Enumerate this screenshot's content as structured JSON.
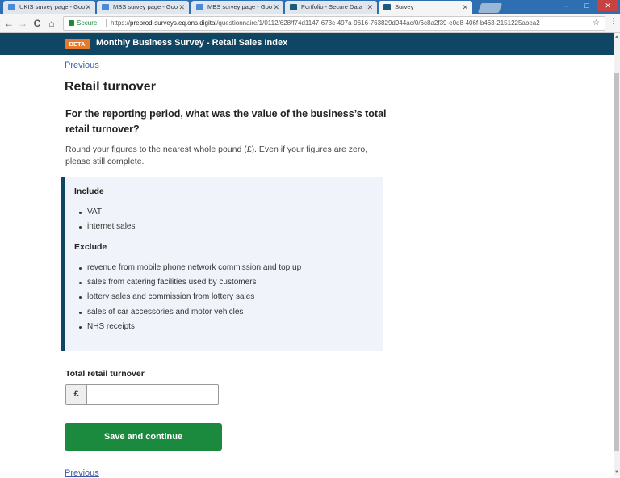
{
  "browser": {
    "tabs": [
      {
        "title": "UKIS survey page - Goo",
        "icon": "doc-icon"
      },
      {
        "title": "MBS survey page - Goo",
        "icon": "doc-icon"
      },
      {
        "title": "MBS survey page - Goo",
        "icon": "doc-icon"
      },
      {
        "title": "Portfolio - Secure Data",
        "icon": "ons-icon"
      },
      {
        "title": "Survey",
        "icon": "ons-icon"
      }
    ],
    "tab_close": "✕",
    "back": "←",
    "forward": "→",
    "reload": "C",
    "home": "⌂",
    "secure_label": "Secure",
    "url_prefix": "https://",
    "url_host": "preprod-surveys.eq.ons.digital",
    "url_path": "/questionnaire/1/0112/628/f74d1147-673c-497a-9616-763829d944ac/0/6c8a2f39-e0d8-406f-b463-2151225abea2",
    "star": "☆",
    "menu": "⋮",
    "window_minimize": "–",
    "window_maximize": "□",
    "window_close": "✕"
  },
  "header": {
    "beta_label": "BETA",
    "survey_title": "Monthly Business Survey - Retail Sales Index"
  },
  "page": {
    "previous_label": "Previous",
    "title": "Retail turnover",
    "question": "For the reporting period, what was the value of the business’s total retail turnover?",
    "description": "Round your figures to the nearest whole pound (£). Even if your figures are zero, please still complete.",
    "include_heading": "Include",
    "include_items": [
      "VAT",
      "internet sales"
    ],
    "exclude_heading": "Exclude",
    "exclude_items": [
      "revenue from mobile phone network commission and top up",
      "sales from catering facilities used by customers",
      "lottery sales and commission from lottery sales",
      "sales of car accessories and motor vehicles",
      "NHS receipts"
    ],
    "field_label": "Total retail turnover",
    "currency_prefix": "£",
    "field_value": "",
    "save_label": "Save and continue",
    "previous_bottom_label": "Previous"
  },
  "colors": {
    "header_bg": "#0f4663",
    "beta_bg": "#e77a2a",
    "button_bg": "#1b8a3f",
    "panel_bg": "#f0f3fa",
    "link": "#3a5ba7"
  }
}
